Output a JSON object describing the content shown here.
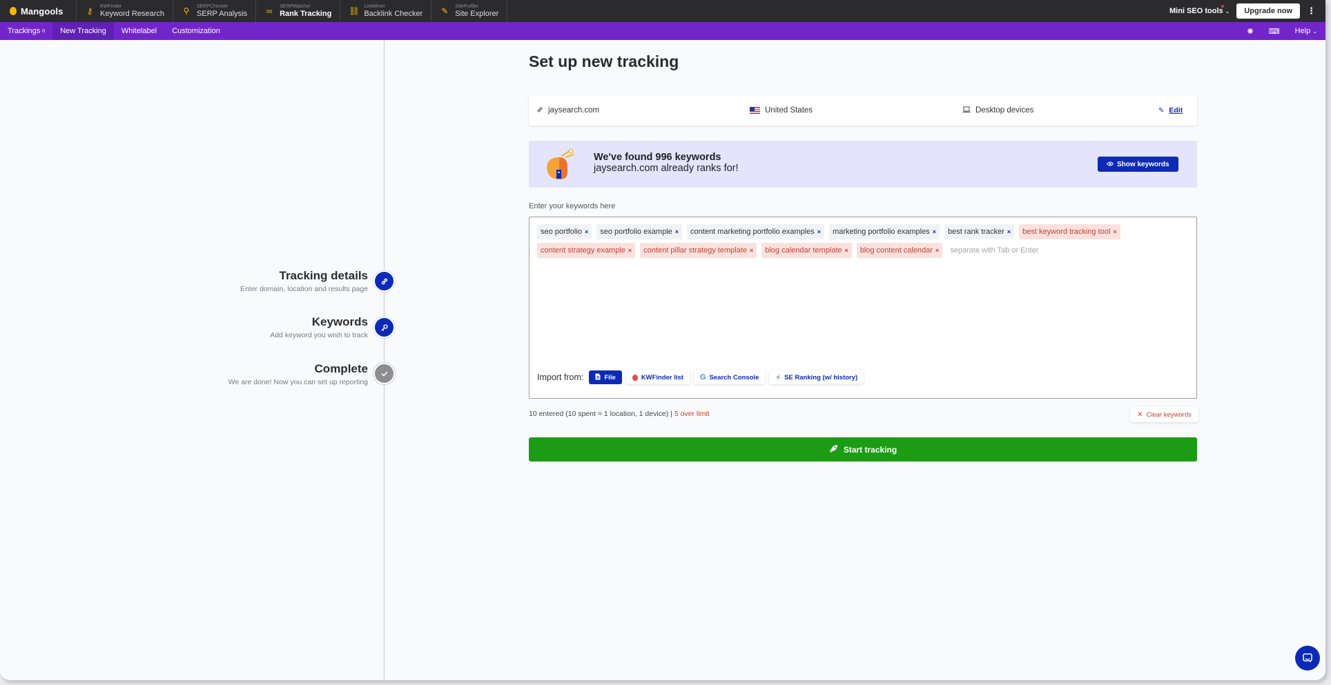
{
  "brand": {
    "name": "Mangools",
    "accent": "#7226c9",
    "primary": "#0d2ab7",
    "success": "#1c9c14",
    "warning": "#c8412f"
  },
  "topbar": {
    "apps": [
      {
        "small": "KWFinder",
        "label": "Keyword Research",
        "icon": "key-icon"
      },
      {
        "small": "SERPChecker",
        "label": "SERP Analysis",
        "icon": "map-pin-icon"
      },
      {
        "small": "SERPWatcher",
        "label": "Rank Tracking",
        "icon": "binoculars-icon"
      },
      {
        "small": "LinkMiner",
        "label": "Backlink Checker",
        "icon": "link-icon"
      },
      {
        "small": "SiteProfiler",
        "label": "Site Explorer",
        "icon": "wrench-icon"
      }
    ],
    "mini_tools": "Mini SEO tools",
    "upgrade": "Upgrade now"
  },
  "subnav": {
    "items": [
      {
        "label": "Trackings",
        "badge": "0"
      },
      {
        "label": "New Tracking"
      },
      {
        "label": "Whitelabel"
      },
      {
        "label": "Customization"
      }
    ],
    "help": "Help"
  },
  "steps": [
    {
      "title": "Tracking details",
      "sub": "Enter domain, location and results page",
      "icon": "link-icon"
    },
    {
      "title": "Keywords",
      "sub": "Add keyword you wish to track",
      "icon": "key-icon"
    },
    {
      "title": "Complete",
      "sub": "We are done! Now you can set up reporting",
      "icon": "check-icon"
    }
  ],
  "main": {
    "title": "Set up new tracking",
    "domain": "jaysearch.com",
    "location": "United States",
    "device": "Desktop devices",
    "edit": "Edit",
    "banner": {
      "line1": "We've found 996 keywords",
      "line2": "jaysearch.com already ranks for!",
      "button": "Show keywords"
    },
    "keywords_label": "Enter your keywords here",
    "keywords": [
      {
        "text": "seo portfolio",
        "over": false
      },
      {
        "text": "seo portfolio example",
        "over": false
      },
      {
        "text": "content marketing portfolio examples",
        "over": false
      },
      {
        "text": "marketing portfolio examples",
        "over": false
      },
      {
        "text": "best rank tracker",
        "over": false
      },
      {
        "text": "best keyword tracking tool",
        "over": true
      },
      {
        "text": "content strategy example",
        "over": true
      },
      {
        "text": "content pillar strategy template",
        "over": true
      },
      {
        "text": "blog calendar template",
        "over": true
      },
      {
        "text": "blog content calendar",
        "over": true
      }
    ],
    "keywords_placeholder": "separate with Tab or Enter",
    "import_label": "Import from:",
    "import_buttons": {
      "file": "File",
      "kwfinder": "KWFinder list",
      "console": "Search Console",
      "seranking": "SE Ranking (w/ history)"
    },
    "status": "10 entered (10 spent = 1 location, 1 device) |",
    "over_limit": "5 over limit",
    "clear": "Clear keywords",
    "start": "Start tracking"
  }
}
